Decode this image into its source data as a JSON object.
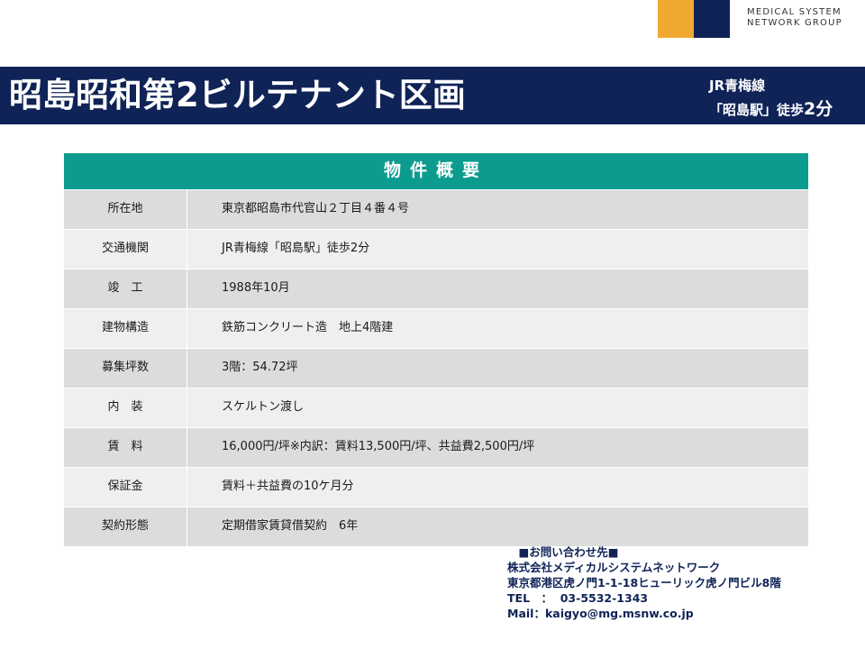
{
  "logo": {
    "line1": "MEDICAL SYSTEM",
    "line2": "NETWORK GROUP",
    "colors": {
      "orange": "#f0a930",
      "navy": "#0f2357"
    }
  },
  "title": "昭島昭和第2ビルテナント区画",
  "station": {
    "line": "JR青梅線",
    "access_prefix": "「昭島駅」徒歩",
    "access_minutes": "2分"
  },
  "table": {
    "header": "物件概要",
    "rows": [
      {
        "label": "所在地",
        "value": "東京都昭島市代官山２丁目４番４号"
      },
      {
        "label": "交通機関",
        "value": "JR青梅線「昭島駅」徒歩2分"
      },
      {
        "label": "竣　工",
        "value": "1988年10月"
      },
      {
        "label": "建物構造",
        "value": "鉄筋コンクリート造　地上4階建"
      },
      {
        "label": "募集坪数",
        "value": "3階：54.72坪"
      },
      {
        "label": "内　装",
        "value": "スケルトン渡し"
      },
      {
        "label": "賃　料",
        "value": "16,000円/坪※内訳：賃料13,500円/坪、共益費2,500円/坪"
      },
      {
        "label": "保証金",
        "value": "賃料＋共益費の10ケ月分"
      },
      {
        "label": "契約形態",
        "value": "定期借家賃貸借契約　6年"
      }
    ]
  },
  "contact": {
    "heading": "　■お問い合わせ先■",
    "company": "株式会社メディカルシステムネットワーク",
    "address": "東京都港区虎ノ門1-1-18ヒューリック虎ノ門ビル8階",
    "tel": "TEL　：  03-5532-1343",
    "mail": "Mail：kaigyo@mg.msnw.co.jp"
  },
  "colors": {
    "navy": "#0f2357",
    "teal": "#0c9c8f",
    "row_dark": "#dcdcdc",
    "row_light": "#efefef"
  }
}
